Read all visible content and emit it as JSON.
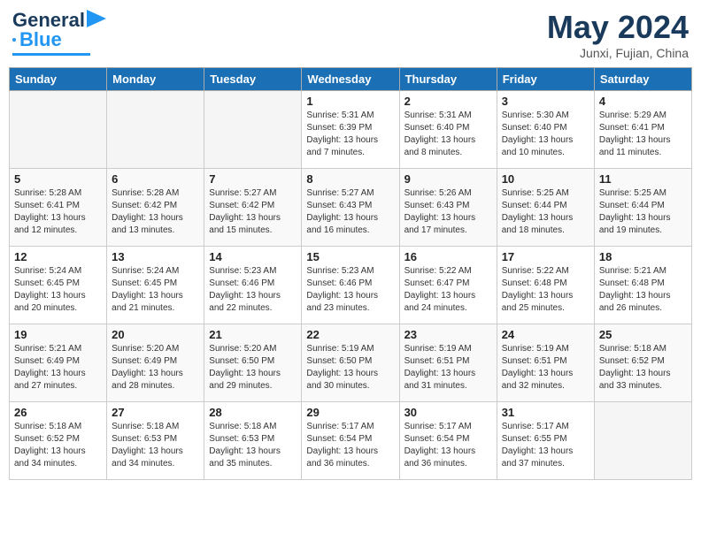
{
  "header": {
    "logo_line1": "General",
    "logo_line2": "Blue",
    "month": "May 2024",
    "location": "Junxi, Fujian, China"
  },
  "days_of_week": [
    "Sunday",
    "Monday",
    "Tuesday",
    "Wednesday",
    "Thursday",
    "Friday",
    "Saturday"
  ],
  "weeks": [
    [
      {
        "day": "",
        "empty": true
      },
      {
        "day": "",
        "empty": true
      },
      {
        "day": "",
        "empty": true
      },
      {
        "day": "1",
        "sunrise": "5:31 AM",
        "sunset": "6:39 PM",
        "daylight": "13 hours and 7 minutes."
      },
      {
        "day": "2",
        "sunrise": "5:31 AM",
        "sunset": "6:40 PM",
        "daylight": "13 hours and 8 minutes."
      },
      {
        "day": "3",
        "sunrise": "5:30 AM",
        "sunset": "6:40 PM",
        "daylight": "13 hours and 10 minutes."
      },
      {
        "day": "4",
        "sunrise": "5:29 AM",
        "sunset": "6:41 PM",
        "daylight": "13 hours and 11 minutes."
      }
    ],
    [
      {
        "day": "5",
        "sunrise": "5:28 AM",
        "sunset": "6:41 PM",
        "daylight": "13 hours and 12 minutes."
      },
      {
        "day": "6",
        "sunrise": "5:28 AM",
        "sunset": "6:42 PM",
        "daylight": "13 hours and 13 minutes."
      },
      {
        "day": "7",
        "sunrise": "5:27 AM",
        "sunset": "6:42 PM",
        "daylight": "13 hours and 15 minutes."
      },
      {
        "day": "8",
        "sunrise": "5:27 AM",
        "sunset": "6:43 PM",
        "daylight": "13 hours and 16 minutes."
      },
      {
        "day": "9",
        "sunrise": "5:26 AM",
        "sunset": "6:43 PM",
        "daylight": "13 hours and 17 minutes."
      },
      {
        "day": "10",
        "sunrise": "5:25 AM",
        "sunset": "6:44 PM",
        "daylight": "13 hours and 18 minutes."
      },
      {
        "day": "11",
        "sunrise": "5:25 AM",
        "sunset": "6:44 PM",
        "daylight": "13 hours and 19 minutes."
      }
    ],
    [
      {
        "day": "12",
        "sunrise": "5:24 AM",
        "sunset": "6:45 PM",
        "daylight": "13 hours and 20 minutes."
      },
      {
        "day": "13",
        "sunrise": "5:24 AM",
        "sunset": "6:45 PM",
        "daylight": "13 hours and 21 minutes."
      },
      {
        "day": "14",
        "sunrise": "5:23 AM",
        "sunset": "6:46 PM",
        "daylight": "13 hours and 22 minutes."
      },
      {
        "day": "15",
        "sunrise": "5:23 AM",
        "sunset": "6:46 PM",
        "daylight": "13 hours and 23 minutes."
      },
      {
        "day": "16",
        "sunrise": "5:22 AM",
        "sunset": "6:47 PM",
        "daylight": "13 hours and 24 minutes."
      },
      {
        "day": "17",
        "sunrise": "5:22 AM",
        "sunset": "6:48 PM",
        "daylight": "13 hours and 25 minutes."
      },
      {
        "day": "18",
        "sunrise": "5:21 AM",
        "sunset": "6:48 PM",
        "daylight": "13 hours and 26 minutes."
      }
    ],
    [
      {
        "day": "19",
        "sunrise": "5:21 AM",
        "sunset": "6:49 PM",
        "daylight": "13 hours and 27 minutes."
      },
      {
        "day": "20",
        "sunrise": "5:20 AM",
        "sunset": "6:49 PM",
        "daylight": "13 hours and 28 minutes."
      },
      {
        "day": "21",
        "sunrise": "5:20 AM",
        "sunset": "6:50 PM",
        "daylight": "13 hours and 29 minutes."
      },
      {
        "day": "22",
        "sunrise": "5:19 AM",
        "sunset": "6:50 PM",
        "daylight": "13 hours and 30 minutes."
      },
      {
        "day": "23",
        "sunrise": "5:19 AM",
        "sunset": "6:51 PM",
        "daylight": "13 hours and 31 minutes."
      },
      {
        "day": "24",
        "sunrise": "5:19 AM",
        "sunset": "6:51 PM",
        "daylight": "13 hours and 32 minutes."
      },
      {
        "day": "25",
        "sunrise": "5:18 AM",
        "sunset": "6:52 PM",
        "daylight": "13 hours and 33 minutes."
      }
    ],
    [
      {
        "day": "26",
        "sunrise": "5:18 AM",
        "sunset": "6:52 PM",
        "daylight": "13 hours and 34 minutes."
      },
      {
        "day": "27",
        "sunrise": "5:18 AM",
        "sunset": "6:53 PM",
        "daylight": "13 hours and 34 minutes."
      },
      {
        "day": "28",
        "sunrise": "5:18 AM",
        "sunset": "6:53 PM",
        "daylight": "13 hours and 35 minutes."
      },
      {
        "day": "29",
        "sunrise": "5:17 AM",
        "sunset": "6:54 PM",
        "daylight": "13 hours and 36 minutes."
      },
      {
        "day": "30",
        "sunrise": "5:17 AM",
        "sunset": "6:54 PM",
        "daylight": "13 hours and 36 minutes."
      },
      {
        "day": "31",
        "sunrise": "5:17 AM",
        "sunset": "6:55 PM",
        "daylight": "13 hours and 37 minutes."
      },
      {
        "day": "",
        "empty": true
      }
    ]
  ]
}
